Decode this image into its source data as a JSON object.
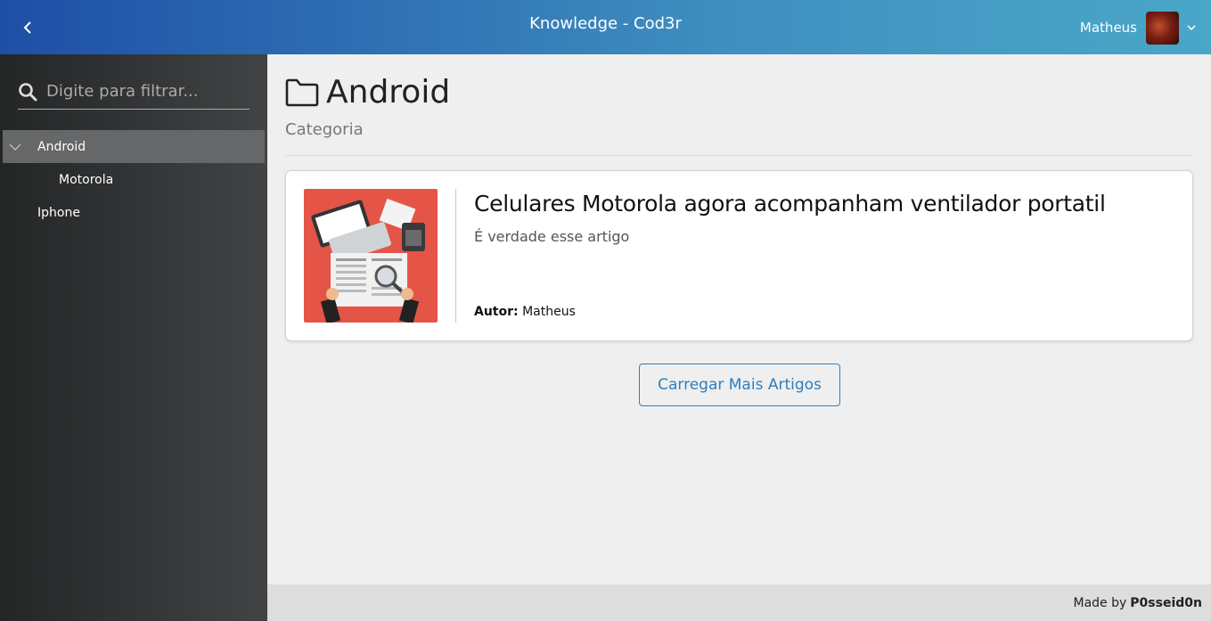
{
  "header": {
    "title": "Knowledge - Cod3r",
    "toggle_icon": "chevron-left-icon",
    "user": {
      "name": "Matheus",
      "dropdown_icon": "chevron-down-icon"
    },
    "gradient_colors": [
      "#1e4fa6",
      "#4aa7c8"
    ]
  },
  "sidebar": {
    "search": {
      "placeholder": "Digite para filtrar...",
      "value": ""
    },
    "tree": [
      {
        "label": "Android",
        "expanded": true,
        "selected": true
      },
      {
        "label": "Motorola"
      },
      {
        "label": "Iphone"
      }
    ]
  },
  "main": {
    "page_title": "Android",
    "page_subtitle": "Categoria",
    "articles": [
      {
        "title": "Celulares Motorola agora acompanham ventilador portatil",
        "description": "É verdade esse artigo",
        "author_label": "Autor:",
        "author_name": "Matheus"
      }
    ],
    "load_more_label": "Carregar Mais Artigos"
  },
  "footer": {
    "made_by_label": "Made by",
    "brand": "P0sseid0n"
  },
  "colors": {
    "accent": "#2c7fc0",
    "article_image_bg": "#e45548",
    "sidebar_selected": "#666768"
  }
}
